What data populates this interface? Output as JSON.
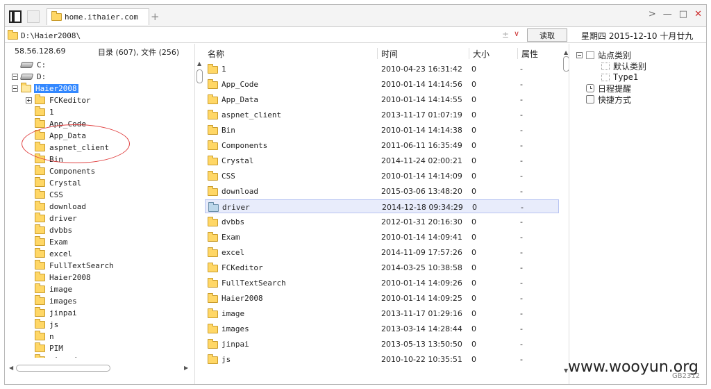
{
  "titlebar": {
    "tab_title": "home.ithaier.com",
    "new_tab": "+",
    "forward": ">",
    "minimize": "—",
    "maximize": "□",
    "close": "✕"
  },
  "address": {
    "path": "D:\\Haier2008\\",
    "plus_minus": "±",
    "dropdown": "∨",
    "read_button": "读取",
    "date": "星期四 2015-12-10 十月廿九"
  },
  "left": {
    "ip": "58.56.128.69",
    "counts": "目录 (607), 文件 (256)",
    "tree": [
      {
        "label": "C:",
        "type": "drive",
        "indent": 0,
        "expander": "none"
      },
      {
        "label": "D:",
        "type": "drive",
        "indent": 0,
        "expander": "minus"
      },
      {
        "label": "Haier2008",
        "type": "folder-open",
        "indent": 1,
        "expander": "minus",
        "selected": true
      },
      {
        "label": "FCKeditor",
        "type": "folder",
        "indent": 2,
        "expander": "plus"
      },
      {
        "label": "1",
        "type": "folder",
        "indent": 2,
        "expander": "none"
      },
      {
        "label": "App_Code",
        "type": "folder",
        "indent": 2,
        "expander": "none"
      },
      {
        "label": "App_Data",
        "type": "folder",
        "indent": 2,
        "expander": "none"
      },
      {
        "label": "aspnet_client",
        "type": "folder",
        "indent": 2,
        "expander": "none"
      },
      {
        "label": "Bin",
        "type": "folder",
        "indent": 2,
        "expander": "none"
      },
      {
        "label": "Components",
        "type": "folder",
        "indent": 2,
        "expander": "none"
      },
      {
        "label": "Crystal",
        "type": "folder",
        "indent": 2,
        "expander": "none"
      },
      {
        "label": "CSS",
        "type": "folder",
        "indent": 2,
        "expander": "none"
      },
      {
        "label": "download",
        "type": "folder",
        "indent": 2,
        "expander": "none"
      },
      {
        "label": "driver",
        "type": "folder",
        "indent": 2,
        "expander": "none"
      },
      {
        "label": "dvbbs",
        "type": "folder",
        "indent": 2,
        "expander": "none"
      },
      {
        "label": "Exam",
        "type": "folder",
        "indent": 2,
        "expander": "none"
      },
      {
        "label": "excel",
        "type": "folder",
        "indent": 2,
        "expander": "none"
      },
      {
        "label": "FullTextSearch",
        "type": "folder",
        "indent": 2,
        "expander": "none"
      },
      {
        "label": "Haier2008",
        "type": "folder",
        "indent": 2,
        "expander": "none"
      },
      {
        "label": "image",
        "type": "folder",
        "indent": 2,
        "expander": "none"
      },
      {
        "label": "images",
        "type": "folder",
        "indent": 2,
        "expander": "none"
      },
      {
        "label": "jinpai",
        "type": "folder",
        "indent": 2,
        "expander": "none"
      },
      {
        "label": "js",
        "type": "folder",
        "indent": 2,
        "expander": "none"
      },
      {
        "label": "n",
        "type": "folder",
        "indent": 2,
        "expander": "none"
      },
      {
        "label": "PIM",
        "type": "folder",
        "indent": 2,
        "expander": "none"
      },
      {
        "label": "qiangdan",
        "type": "folder",
        "indent": 2,
        "expander": "none"
      }
    ]
  },
  "files": {
    "columns": {
      "name": "名称",
      "time": "时间",
      "size": "大小",
      "attr": "属性"
    },
    "rows": [
      {
        "name": "1",
        "time": "2010-04-23 16:31:42",
        "size": "0",
        "attr": "-"
      },
      {
        "name": "App_Code",
        "time": "2010-01-14 14:14:56",
        "size": "0",
        "attr": "-"
      },
      {
        "name": "App_Data",
        "time": "2010-01-14 14:14:55",
        "size": "0",
        "attr": "-"
      },
      {
        "name": "aspnet_client",
        "time": "2013-11-17 01:07:19",
        "size": "0",
        "attr": "-"
      },
      {
        "name": "Bin",
        "time": "2010-01-14 14:14:38",
        "size": "0",
        "attr": "-"
      },
      {
        "name": "Components",
        "time": "2011-06-11 16:35:49",
        "size": "0",
        "attr": "-"
      },
      {
        "name": "Crystal",
        "time": "2014-11-24 02:00:21",
        "size": "0",
        "attr": "-"
      },
      {
        "name": "CSS",
        "time": "2010-01-14 14:14:09",
        "size": "0",
        "attr": "-"
      },
      {
        "name": "download",
        "time": "2015-03-06 13:48:20",
        "size": "0",
        "attr": "-"
      },
      {
        "name": "driver",
        "time": "2014-12-18 09:34:29",
        "size": "0",
        "attr": "-",
        "selected": true
      },
      {
        "name": "dvbbs",
        "time": "2012-01-31 20:16:30",
        "size": "0",
        "attr": "-"
      },
      {
        "name": "Exam",
        "time": "2010-01-14 14:09:41",
        "size": "0",
        "attr": "-"
      },
      {
        "name": "excel",
        "time": "2014-11-09 17:57:26",
        "size": "0",
        "attr": "-"
      },
      {
        "name": "FCKeditor",
        "time": "2014-03-25 10:38:58",
        "size": "0",
        "attr": "-"
      },
      {
        "name": "FullTextSearch",
        "time": "2010-01-14 14:09:26",
        "size": "0",
        "attr": "-"
      },
      {
        "name": "Haier2008",
        "time": "2010-01-14 14:09:25",
        "size": "0",
        "attr": "-"
      },
      {
        "name": "image",
        "time": "2013-11-17 01:29:16",
        "size": "0",
        "attr": "-"
      },
      {
        "name": "images",
        "time": "2013-03-14 14:28:44",
        "size": "0",
        "attr": "-"
      },
      {
        "name": "jinpai",
        "time": "2013-05-13 13:50:50",
        "size": "0",
        "attr": "-"
      },
      {
        "name": "js",
        "time": "2010-10-22 10:35:51",
        "size": "0",
        "attr": "-"
      }
    ]
  },
  "right": {
    "items": [
      {
        "label": "站点类别",
        "indent": 0,
        "icon": "box",
        "expander": "minus"
      },
      {
        "label": "默认类别",
        "indent": 1,
        "icon": "dotted-box",
        "expander": "none"
      },
      {
        "label": "Type1",
        "indent": 1,
        "icon": "dotted-box",
        "expander": "none"
      },
      {
        "label": "日程提醒",
        "indent": 0,
        "icon": "clock",
        "expander": "none"
      },
      {
        "label": "快捷方式",
        "indent": 0,
        "icon": "hand",
        "expander": "none"
      }
    ]
  },
  "watermark": "www.wooyun.org",
  "encoding": "GB2312",
  "icons": [
    "panel-toggle-icon",
    "folder-icon",
    "drive-icon",
    "expander-icon",
    "clock-icon",
    "shortcut-icon"
  ]
}
